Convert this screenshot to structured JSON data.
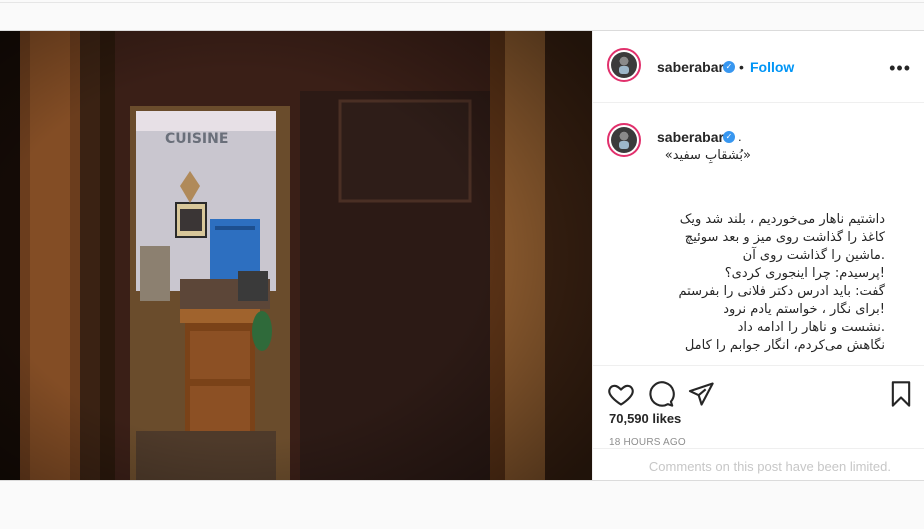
{
  "post": {
    "username": "saberabar",
    "follow_label": "Follow",
    "more_label": "•••",
    "caption": {
      "username": "saberabar",
      "suffix": ".",
      "lines": [
        "«بُشقابِ سفید»",
        "داشتیم ناهار می‌خوردیم ، بلند شد ویک",
        "کاغذ را گذاشت روی میز و بعد سوئیچ",
        ".ماشین را گذاشت روی آن",
        "!پرسیدم: چرا اینجوری کردی؟",
        "گفت: باید ادرس دکتر فلانی را بفرستم",
        "!برای نگار ، خواستم یادم نرود",
        ".نشست و ناهار را ادامه داد",
        "نگاهش می‌کردم، انگار جوابم را کامل"
      ]
    },
    "likes": "70,590 likes",
    "time": "18 HOURS AGO",
    "comments_limited": "Comments on this post have been limited.",
    "photo": {
      "sign_text": "CUISINE"
    }
  },
  "colors": {
    "accent": "#0095f6",
    "verified": "#3897f0",
    "story_ring": "#e1306c",
    "muted": "#8e8e8e"
  },
  "icons": {
    "like": "heart-icon",
    "comment": "comment-icon",
    "share": "paper-plane-icon",
    "save": "bookmark-icon",
    "more": "more-options-icon"
  }
}
